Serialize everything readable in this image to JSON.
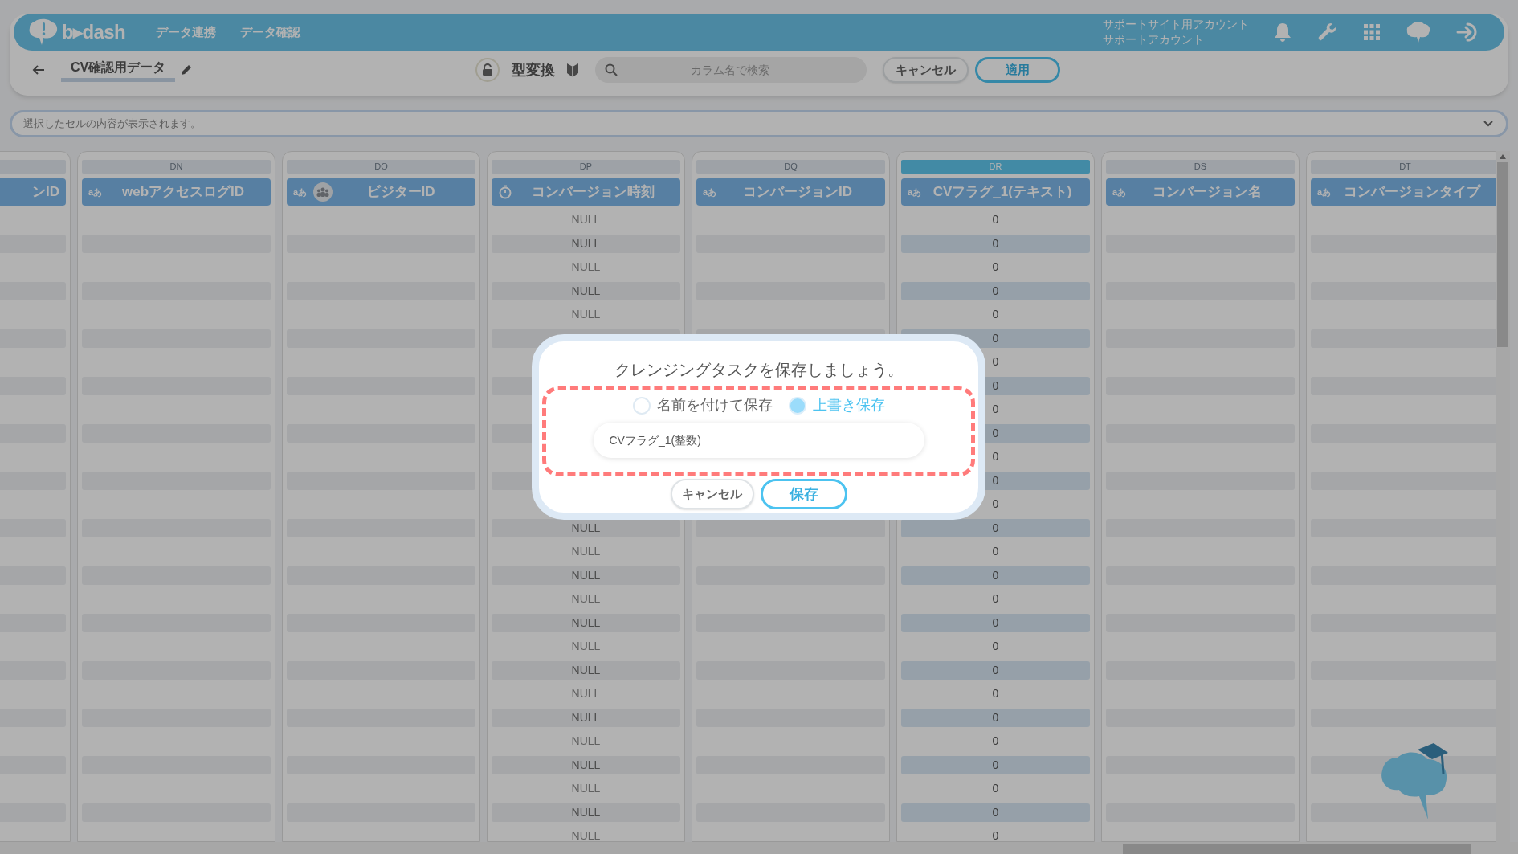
{
  "header": {
    "logo_text": "b▸dash",
    "nav": [
      {
        "label": "データ連携"
      },
      {
        "label": "データ確認"
      }
    ],
    "account": {
      "line1": "サポートサイト用アカウント",
      "line2": "サポートアカウント"
    }
  },
  "toolbar": {
    "title": "CV確認用データ",
    "mode_label": "型変換",
    "search": {
      "placeholder": "カラム名で検索"
    },
    "buttons": [
      {
        "label": "キャンセル",
        "kind": "secondary"
      },
      {
        "label": "適用",
        "kind": "primary"
      }
    ]
  },
  "cell_bar": {
    "placeholder": "選択したセルの内容が表示されます。"
  },
  "columns": [
    {
      "name": "ンID",
      "kind": "text",
      "selected": false
    },
    {
      "letter": "DN",
      "name": "webアクセスログID",
      "kind": "text",
      "type_label": "aあ",
      "selected": false
    },
    {
      "letter": "DO",
      "name": "ビジターID",
      "kind": "text",
      "type_label": "aあ",
      "group_icon": true,
      "selected": false
    },
    {
      "letter": "DP",
      "name": "コンバージョン時刻",
      "kind": "time",
      "selected": false,
      "cells": [
        "NULL",
        "NULL",
        "NULL",
        "NULL",
        "NULL",
        null,
        null,
        null,
        null,
        null,
        null,
        null,
        null,
        "NULL",
        "NULL",
        "NULL",
        "NULL",
        "NULL",
        "NULL",
        "NULL",
        "NULL",
        "NULL",
        "NULL",
        "NULL",
        "NULL",
        "NULL",
        "NULL"
      ]
    },
    {
      "letter": "DQ",
      "name": "コンバージョンID",
      "kind": "text",
      "type_label": "aあ",
      "selected": false
    },
    {
      "letter": "DR",
      "name": "CVフラグ_1(テキスト)",
      "kind": "text",
      "type_label": "aあ",
      "selected": true,
      "cells": [
        "0",
        "0",
        "0",
        "0",
        "0",
        "0",
        "0",
        "0",
        "0",
        "0",
        "0",
        "0",
        "0",
        "0",
        "0",
        "0",
        "0",
        "0",
        "0",
        "0",
        "0",
        "0",
        "0",
        "0",
        "0",
        "0",
        "0"
      ]
    },
    {
      "letter": "DS",
      "name": "コンバージョン名",
      "kind": "text",
      "type_label": "aあ",
      "selected": false
    },
    {
      "letter": "DT",
      "name": "コンバージョンタイプ",
      "kind": "text",
      "type_label": "aあ",
      "selected": false
    }
  ],
  "dialog": {
    "title": "クレンジングタスクを保存しましょう。",
    "options": [
      {
        "label": "名前を付けて保存",
        "selected": false
      },
      {
        "label": "上書き保存",
        "selected": true
      }
    ],
    "name_field": {
      "value": "CVフラグ_1(整数)"
    },
    "buttons": [
      {
        "label": "キャンセル",
        "kind": "secondary"
      },
      {
        "label": "保存",
        "kind": "primary"
      }
    ]
  }
}
